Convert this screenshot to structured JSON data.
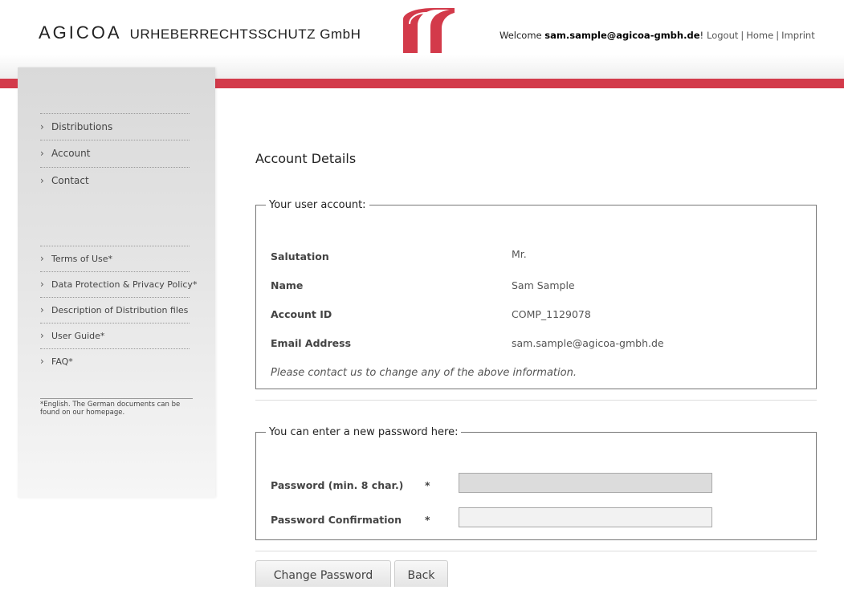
{
  "header": {
    "brand_main": "AGICOA",
    "brand_sub": "URHEBERRECHTSSCHUTZ GmbH",
    "welcome_prefix": "Welcome ",
    "welcome_user": "sam.sample@agicoa-gmbh.de",
    "welcome_suffix": "!",
    "links": {
      "logout": "Logout",
      "home": "Home",
      "imprint": "Imprint"
    },
    "accent_color": "#d33a4a"
  },
  "sidebar": {
    "main_nav": [
      {
        "label": "Distributions"
      },
      {
        "label": "Account"
      },
      {
        "label": "Contact"
      }
    ],
    "doc_nav": [
      {
        "label": "Terms of Use*"
      },
      {
        "label": "Data Protection & Privacy Policy*"
      },
      {
        "label": "Description of Distribution files"
      },
      {
        "label": "User Guide*"
      },
      {
        "label": "FAQ*"
      }
    ],
    "footnote": "*English. The German documents can be found on our homepage."
  },
  "main": {
    "title": "Account Details",
    "account_legend": "Your user account:",
    "fields": [
      {
        "label": "Salutation",
        "value": "Mr."
      },
      {
        "label": "Name",
        "value": "Sam Sample"
      },
      {
        "label": "Account ID",
        "value": "COMP_1129078"
      },
      {
        "label": "Email Address",
        "value": "sam.sample@agicoa-gmbh.de"
      }
    ],
    "contact_note": "Please contact us to change any of the above information.",
    "password_legend": "You can enter a new password here:",
    "password_label": "Password (min. 8 char.)",
    "confirm_label": "Password Confirmation",
    "required_mark": "*",
    "password_value": "",
    "confirm_value": "",
    "change_button": "Change Password",
    "back_button": "Back"
  }
}
